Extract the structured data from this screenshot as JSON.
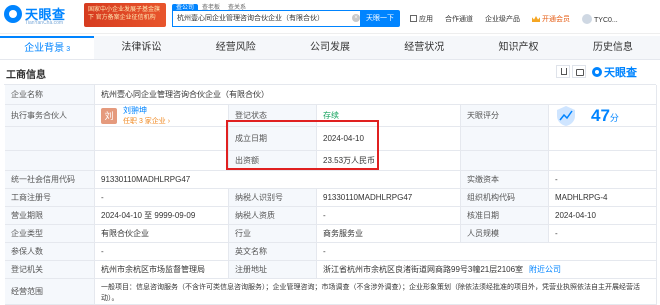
{
  "brand": {
    "name": "天眼查",
    "domain": "TianYanCha.com",
    "promo": "国家中小企业发展子基金旗下 官方备案企业征信机构"
  },
  "search": {
    "tabs": [
      "查公司",
      "查老板",
      "查关系"
    ],
    "value": "杭州壹心同企业管理咨询合伙企业（有限合伙）",
    "clear": "×",
    "button": "天眼一下"
  },
  "topnav": {
    "apps": "应用",
    "partner": "合作通道",
    "enterprise": "企业级产品",
    "vip": "开通会员",
    "user": "TYC0..."
  },
  "tabs": [
    {
      "label": "企业背景",
      "count": "3"
    },
    {
      "label": "法律诉讼",
      "count": ""
    },
    {
      "label": "经营风险",
      "count": ""
    },
    {
      "label": "公司发展",
      "count": ""
    },
    {
      "label": "经营状况",
      "count": ""
    },
    {
      "label": "知识产权",
      "count": ""
    },
    {
      "label": "历史信息",
      "count": ""
    }
  ],
  "section": {
    "title": "工商信息",
    "watermark": "天眼查"
  },
  "info": {
    "company_name_label": "企业名称",
    "company_name": "杭州壹心同企业管理咨询合伙企业（有限合伙）",
    "partner_label": "执行事务合伙人",
    "partner_avatar": "刘",
    "partner_name": "刘翀坤",
    "partner_sub": "任职 3 家企业 ›",
    "status_label": "登记状态",
    "status": "存续",
    "founded_label": "成立日期",
    "founded": "2024-04-10",
    "capital_label": "出资额",
    "capital": "23.53万人民币",
    "score_label": "天眼评分",
    "score": "47",
    "score_unit": "分",
    "credit_code_label": "统一社会信用代码",
    "credit_code": "91330110MADHLRPG47",
    "paid_capital_label": "实缴资本",
    "paid_capital": "-",
    "reg_no_label": "工商注册号",
    "reg_no": "-",
    "taxpayer_id_label": "纳税人识别号",
    "taxpayer_id": "91330110MADHLRPG47",
    "org_code_label": "组织机构代码",
    "org_code": "MADHLRPG-4",
    "term_label": "营业期限",
    "term": "2024-04-10 至 9999-09-09",
    "taxpayer_q_label": "纳税人资质",
    "taxpayer_q": "-",
    "approved_label": "核准日期",
    "approved": "2024-04-10",
    "type_label": "企业类型",
    "type": "有限合伙企业",
    "industry_label": "行业",
    "industry": "商务服务业",
    "staff_label": "人员规模",
    "staff": "-",
    "insured_label": "参保人数",
    "insured": "-",
    "en_name_label": "英文名称",
    "en_name": "-",
    "authority_label": "登记机关",
    "authority": "杭州市余杭区市场监督管理局",
    "address_label": "注册地址",
    "address": "浙江省杭州市余杭区良渚街道网商路99号3幢21层2106室",
    "address_link": "附近公司",
    "scope_label": "经营范围",
    "scope": "一般项目：信息咨询服务（不含许可类信息咨询服务）；企业管理咨询；市场调查（不含涉外调查）；企业形象策划（除依法须经批准的项目外，凭营业执照依法自主开展经营活动）。"
  }
}
